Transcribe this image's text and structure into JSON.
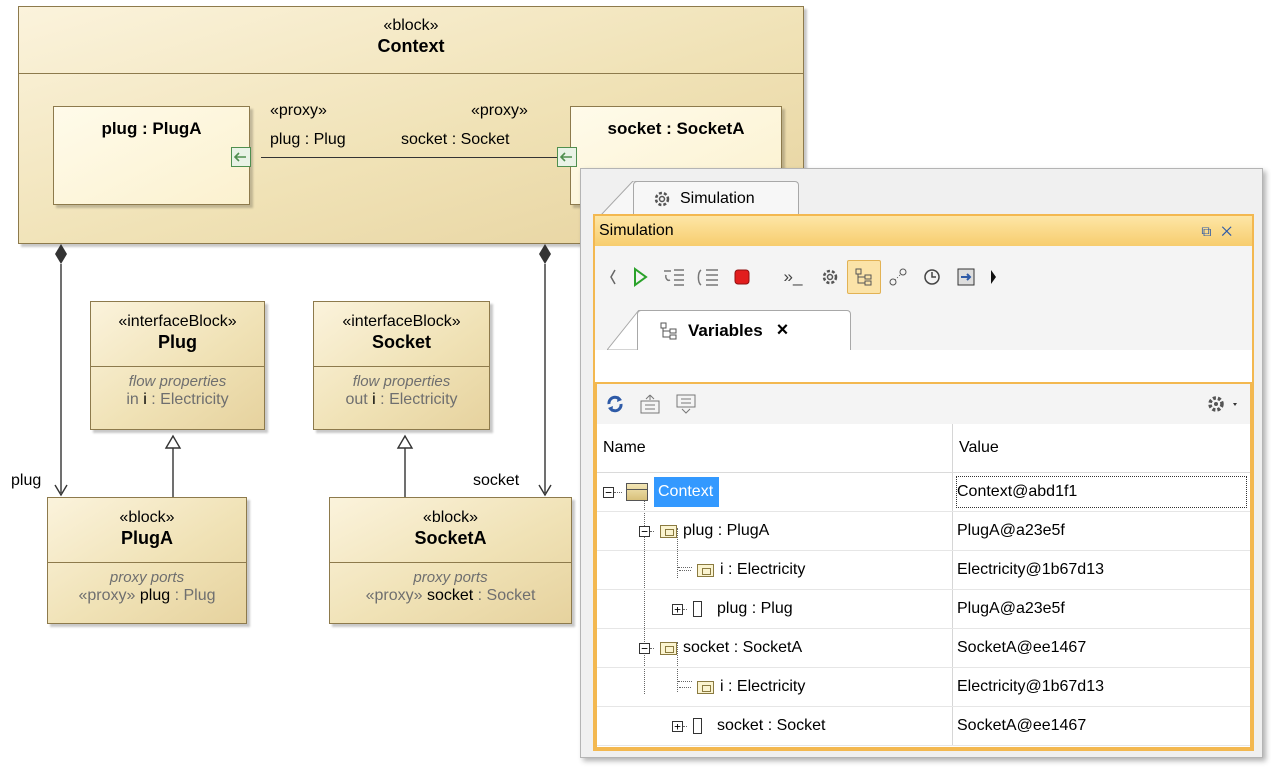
{
  "diagram": {
    "context": {
      "stereotype": "«block»",
      "name": "Context"
    },
    "plug_part": {
      "label": "plug : PlugA"
    },
    "socket_part": {
      "label": "socket : SocketA"
    },
    "plug_port_label": {
      "stereotype": "«proxy»",
      "name": "plug : Plug"
    },
    "socket_port_label": {
      "stereotype": "«proxy»",
      "name": "socket : Socket"
    },
    "plug_block": {
      "stereotype": "«interfaceBlock»",
      "name": "Plug",
      "compartment": "flow properties",
      "dir": "in",
      "prop": "i",
      "type": " : Electricity"
    },
    "socket_block": {
      "stereotype": "«interfaceBlock»",
      "name": "Socket",
      "compartment": "flow properties",
      "dir": "out",
      "prop": "i",
      "type": " : Electricity"
    },
    "pluga_block": {
      "stereotype": "«block»",
      "name": "PlugA",
      "compartment": "proxy ports",
      "port_stereo": "«proxy»",
      "port_name": "plug",
      "port_type": " : Plug"
    },
    "socketa_block": {
      "stereotype": "«block»",
      "name": "SocketA",
      "compartment": "proxy ports",
      "port_stereo": "«proxy»",
      "port_name": "socket",
      "port_type": " : Socket"
    },
    "assoc_plug_label": "plug",
    "assoc_socket_label": "socket"
  },
  "simulation": {
    "tab_label": "Simulation",
    "panel_title": "Simulation",
    "panel_controls": [
      "restore-icon",
      "close-icon"
    ],
    "toolbar_icons": [
      "back-icon",
      "run-icon",
      "step-into-icon",
      "step-over-icon",
      "terminate-icon",
      "console-icon",
      "sessions-icon",
      "variables-icon",
      "breakpoints-icon",
      "triggers-icon",
      "export-icon",
      "more-icon"
    ],
    "variables_tab_label": "Variables",
    "variables_tab_close": "×",
    "columns": {
      "name": "Name",
      "value": "Value"
    },
    "rows": [
      {
        "name": "Context",
        "value": "Context@abd1f1",
        "level": 0,
        "selected": true
      },
      {
        "name": "plug : PlugA",
        "value": "PlugA@a23e5f",
        "level": 1
      },
      {
        "name": "i : Electricity",
        "value": "Electricity@1b67d13",
        "level": 2
      },
      {
        "name": "plug : Plug",
        "value": "PlugA@a23e5f",
        "level": 2
      },
      {
        "name": "socket : SocketA",
        "value": "SocketA@ee1467",
        "level": 1
      },
      {
        "name": "i : Electricity",
        "value": "Electricity@1b67d13",
        "level": 2
      },
      {
        "name": "socket : Socket",
        "value": "SocketA@ee1467",
        "level": 2
      }
    ]
  },
  "colors": {
    "block_fill": "#f0e2b6",
    "orange_frame": "#f3b850",
    "selection": "#3399ff",
    "port_green": "#4f8f4f"
  }
}
